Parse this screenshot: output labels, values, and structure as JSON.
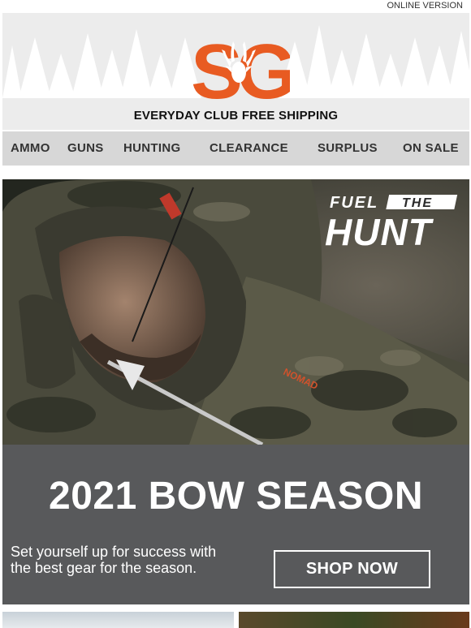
{
  "top": {
    "online_version": "ONLINE VERSION"
  },
  "header": {
    "shipping": "EVERYDAY CLUB FREE SHIPPING",
    "brand_color": "#e85b22"
  },
  "nav": [
    {
      "label": "AMMO"
    },
    {
      "label": "GUNS"
    },
    {
      "label": "HUNTING"
    },
    {
      "label": "CLEARANCE"
    },
    {
      "label": "SURPLUS"
    },
    {
      "label": "ON SALE"
    }
  ],
  "hero": {
    "tag_top": "FUEL",
    "tag_mid": "THE",
    "tag_bottom": "HUNT",
    "jacket_text": "NOMAD"
  },
  "banner": {
    "title": "2021 BOW SEASON",
    "description": "Set yourself up for success with the best gear for the season.",
    "cta": "SHOP NOW"
  }
}
